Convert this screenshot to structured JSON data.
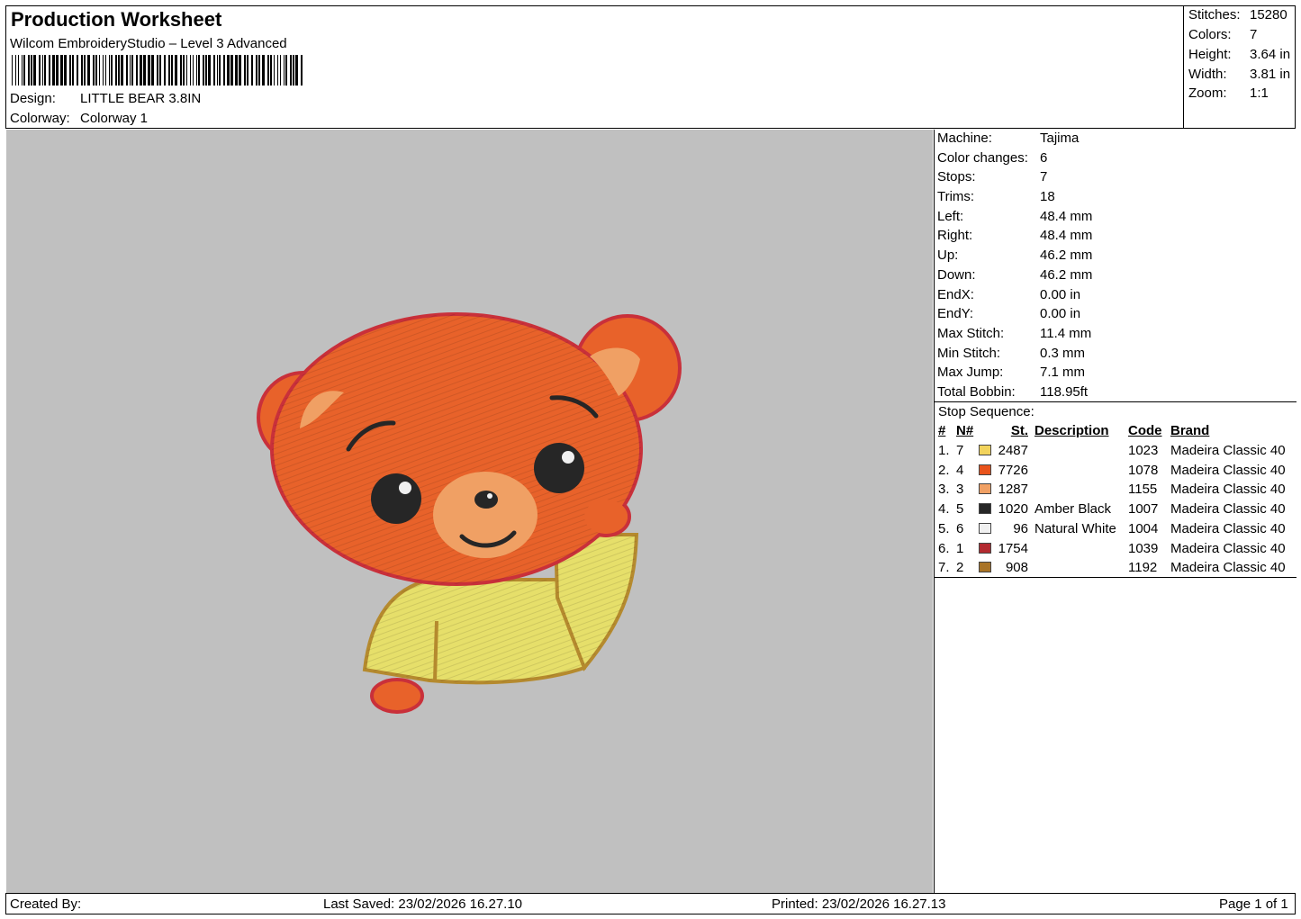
{
  "header": {
    "title": "Production Worksheet",
    "software": "Wilcom EmbroideryStudio – Level 3 Advanced",
    "design_label": "Design:",
    "design_value": "LITTLE BEAR 3.8IN",
    "colorway_label": "Colorway:",
    "colorway_value": "Colorway 1"
  },
  "summary": {
    "stitches_label": "Stitches:",
    "stitches": "15280",
    "colors_label": "Colors:",
    "colors": "7",
    "height_label": "Height:",
    "height": "3.64 in",
    "width_label": "Width:",
    "width": "3.81 in",
    "zoom_label": "Zoom:",
    "zoom": "1:1"
  },
  "machine_info": [
    {
      "label": "Machine:",
      "value": "Tajima"
    },
    {
      "label": "Color changes:",
      "value": "6"
    },
    {
      "label": "Stops:",
      "value": "7"
    },
    {
      "label": "Trims:",
      "value": "18"
    },
    {
      "label": "Left:",
      "value": "48.4 mm"
    },
    {
      "label": "Right:",
      "value": "48.4 mm"
    },
    {
      "label": "Up:",
      "value": "46.2 mm"
    },
    {
      "label": "Down:",
      "value": "46.2 mm"
    },
    {
      "label": "EndX:",
      "value": "0.00 in"
    },
    {
      "label": "EndY:",
      "value": "0.00 in"
    },
    {
      "label": "Max Stitch:",
      "value": "11.4 mm"
    },
    {
      "label": "Min Stitch:",
      "value": "0.3 mm"
    },
    {
      "label": "Max Jump:",
      "value": "7.1 mm"
    },
    {
      "label": "Total Bobbin:",
      "value": "118.95ft"
    }
  ],
  "stop_sequence": {
    "title": "Stop Sequence:",
    "headers": {
      "idx": "#",
      "n": "N#",
      "st": "St.",
      "desc": "Description",
      "code": "Code",
      "brand": "Brand"
    },
    "rows": [
      {
        "idx": "1.",
        "n": "7",
        "color": "#f2d35c",
        "st": "2487",
        "desc": "",
        "code": "1023",
        "brand": "Madeira Classic 40"
      },
      {
        "idx": "2.",
        "n": "4",
        "color": "#e8531c",
        "st": "7726",
        "desc": "",
        "code": "1078",
        "brand": "Madeira Classic 40"
      },
      {
        "idx": "3.",
        "n": "3",
        "color": "#f0a064",
        "st": "1287",
        "desc": "",
        "code": "1155",
        "brand": "Madeira Classic 40"
      },
      {
        "idx": "4.",
        "n": "5",
        "color": "#262626",
        "st": "1020",
        "desc": "Amber Black",
        "code": "1007",
        "brand": "Madeira Classic 40"
      },
      {
        "idx": "5.",
        "n": "6",
        "color": "#f0f0f0",
        "st": "96",
        "desc": "Natural White",
        "code": "1004",
        "brand": "Madeira Classic 40"
      },
      {
        "idx": "6.",
        "n": "1",
        "color": "#b32a30",
        "st": "1754",
        "desc": "",
        "code": "1039",
        "brand": "Madeira Classic 40"
      },
      {
        "idx": "7.",
        "n": "2",
        "color": "#a97427",
        "st": "908",
        "desc": "",
        "code": "1192",
        "brand": "Madeira Classic 40"
      }
    ]
  },
  "footer": {
    "created_by": "Created By:",
    "last_saved": "Last Saved: 23/02/2026 16.27.10",
    "printed": "Printed: 23/02/2026 16.27.13",
    "page": "Page 1 of 1"
  }
}
